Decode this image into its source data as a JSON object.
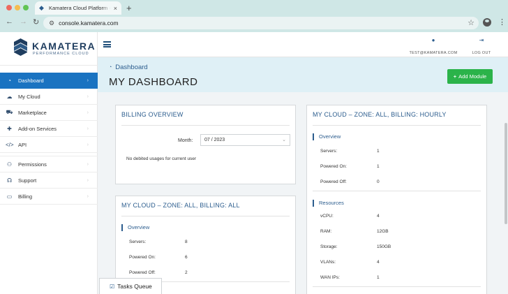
{
  "browser": {
    "tab_title": "Kamatera Cloud Platform - Dashboard",
    "url": "console.kamatera.com",
    "new_tab": "+",
    "tab_close": "×"
  },
  "brand": {
    "name": "KAMATERA",
    "tagline": "PERFORMANCE CLOUD"
  },
  "sidebar": {
    "items": [
      {
        "label": "Dashboard",
        "icon": "dashboard-icon",
        "glyph": "◔",
        "active": true
      },
      {
        "label": "My Cloud",
        "icon": "cloud-icon",
        "glyph": "☁"
      },
      {
        "label": "Marketplace",
        "icon": "cart-icon",
        "glyph": "⛟"
      },
      {
        "label": "Add-on Services",
        "icon": "puzzle-icon",
        "glyph": "✚"
      },
      {
        "label": "API",
        "icon": "code-icon",
        "glyph": "</>"
      },
      {
        "label": "Permissions",
        "icon": "users-icon",
        "glyph": "⚇"
      },
      {
        "label": "Support",
        "icon": "headset-icon",
        "glyph": "☊"
      },
      {
        "label": "Billing",
        "icon": "credit-card-icon",
        "glyph": "▭"
      }
    ],
    "chevron": "›"
  },
  "topbar": {
    "account": "TEST@KAMATERA.COM",
    "logout": "LOG OUT"
  },
  "header": {
    "breadcrumb": "Dashboard",
    "title": "MY DASHBOARD",
    "add_module": "Add Module"
  },
  "billing": {
    "title": "BILLING OVERVIEW",
    "month_label": "Month:",
    "month_value": "07 / 2023",
    "empty": "No debited usages for current user"
  },
  "cloud_all": {
    "title": "MY CLOUD – ZONE: ALL, BILLING: ALL",
    "overview": "Overview",
    "rows": [
      {
        "label": "Servers:",
        "value": "8"
      },
      {
        "label": "Powered On:",
        "value": "6"
      },
      {
        "label": "Powered Off:",
        "value": "2"
      }
    ]
  },
  "cloud_hourly": {
    "title": "MY CLOUD – ZONE: ALL, BILLING: HOURLY",
    "overview": "Overview",
    "overview_rows": [
      {
        "label": "Servers:",
        "value": "1"
      },
      {
        "label": "Powered On:",
        "value": "1"
      },
      {
        "label": "Powered Off:",
        "value": "0"
      }
    ],
    "resources": "Resources",
    "resource_rows": [
      {
        "label": "vCPU:",
        "value": "4"
      },
      {
        "label": "RAM:",
        "value": "12GB"
      },
      {
        "label": "Storage:",
        "value": "150GB"
      },
      {
        "label": "VLANs:",
        "value": "4"
      },
      {
        "label": "WAN IPs:",
        "value": "1"
      }
    ]
  },
  "tasks_queue": "Tasks Queue",
  "colors": {
    "accent": "#1a73c1",
    "success": "#2bb34a",
    "header_bg": "#dff0f6"
  }
}
